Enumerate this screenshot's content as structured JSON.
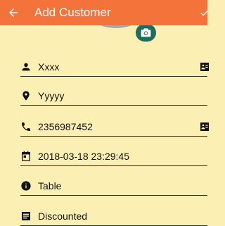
{
  "app_bar": {
    "title": "Add Customer",
    "back_icon": "arrow-left-icon",
    "confirm_icon": "check-icon",
    "background": "#f4733b"
  },
  "profile": {
    "camera_icon": "camera-icon",
    "camera_button_color": "#1d6d5c"
  },
  "fields": {
    "name": {
      "value": "Xxxx",
      "icon": "person-icon",
      "right_icon": "contact-card-icon"
    },
    "address": {
      "value": "Yyyyy",
      "icon": "location-pin-icon"
    },
    "phone": {
      "value": "2356987452",
      "icon": "phone-icon",
      "right_icon": "contact-card-icon"
    },
    "datetime": {
      "value": "2018-03-18 23:29:45",
      "icon": "calendar-icon"
    },
    "source": {
      "value": "Table",
      "icon": "info-icon"
    },
    "price_type": {
      "value": "Discounted",
      "icon": "list-icon"
    }
  },
  "colors": {
    "page_background": "#fcefb3",
    "text": "#111111"
  }
}
